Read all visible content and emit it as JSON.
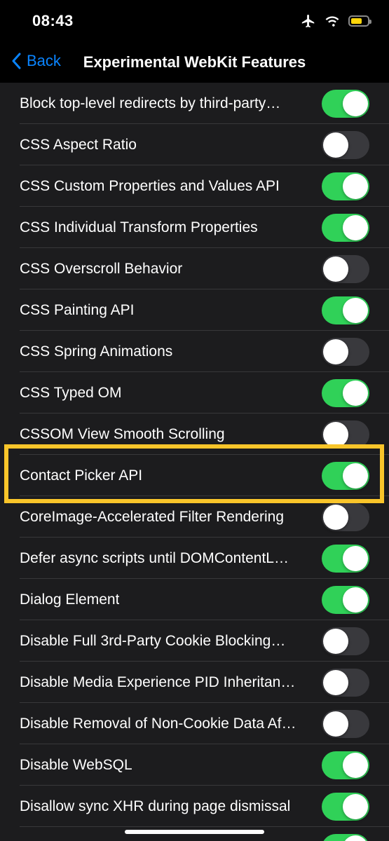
{
  "status": {
    "time": "08:43"
  },
  "nav": {
    "back_label": "Back",
    "title": "Experimental WebKit Features"
  },
  "colors": {
    "accent": "#0a84ff",
    "toggle_on": "#30d158",
    "toggle_off": "#39393d",
    "highlight": "#f9c52a"
  },
  "items": [
    {
      "label": "Block top-level redirects by third-party…",
      "on": true
    },
    {
      "label": "CSS Aspect Ratio",
      "on": false
    },
    {
      "label": "CSS Custom Properties and Values API",
      "on": true
    },
    {
      "label": "CSS Individual Transform Properties",
      "on": true
    },
    {
      "label": "CSS Overscroll Behavior",
      "on": false
    },
    {
      "label": "CSS Painting API",
      "on": true
    },
    {
      "label": "CSS Spring Animations",
      "on": false
    },
    {
      "label": "CSS Typed OM",
      "on": true
    },
    {
      "label": "CSSOM View Smooth Scrolling",
      "on": false
    },
    {
      "label": "Contact Picker API",
      "on": true
    },
    {
      "label": "CoreImage-Accelerated Filter Rendering",
      "on": false
    },
    {
      "label": "Defer async scripts until DOMContentL…",
      "on": true
    },
    {
      "label": "Dialog Element",
      "on": true
    },
    {
      "label": "Disable Full 3rd-Party Cookie Blocking…",
      "on": false
    },
    {
      "label": "Disable Media Experience PID Inheritan…",
      "on": false
    },
    {
      "label": "Disable Removal of Non-Cookie Data Af…",
      "on": false
    },
    {
      "label": "Disable WebSQL",
      "on": true
    },
    {
      "label": "Disallow sync XHR during page dismissal",
      "on": true
    },
    {
      "label": "",
      "on": true
    }
  ]
}
